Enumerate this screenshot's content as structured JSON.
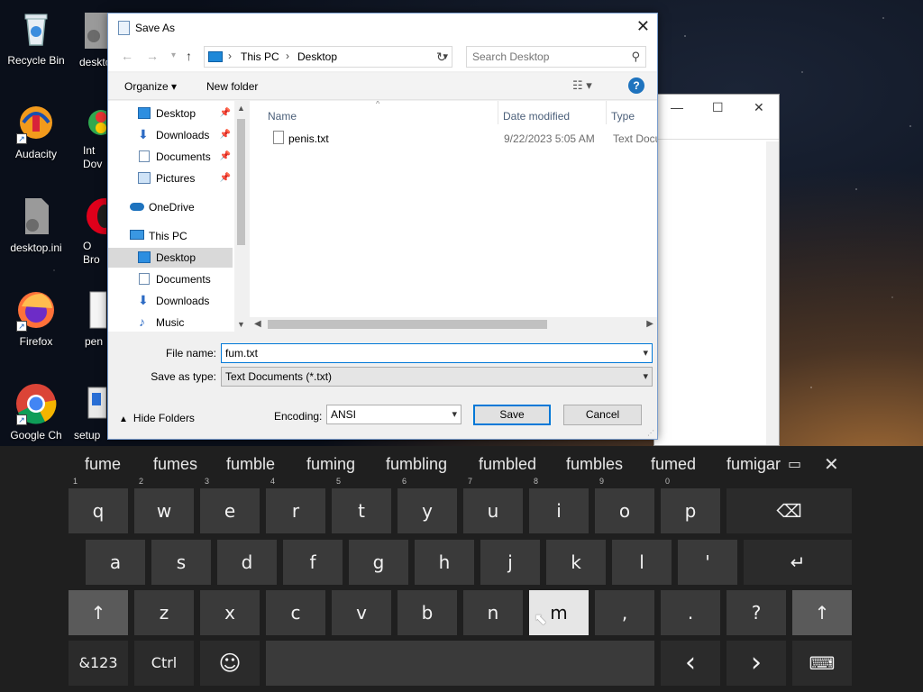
{
  "desktop": {
    "icons": [
      {
        "label": "Recycle Bin"
      },
      {
        "label": "Audacity"
      },
      {
        "label": "desktop.ini"
      },
      {
        "label": "Firefox"
      },
      {
        "label": "Google Ch"
      }
    ],
    "partial_icons": [
      {
        "label": "deskto"
      },
      {
        "label": "Int Dov"
      },
      {
        "label": "O Bro"
      },
      {
        "label": "pen"
      },
      {
        "label": "setup"
      }
    ]
  },
  "dialog": {
    "title": "Save As",
    "close_glyph": "✕",
    "address": {
      "crumbs": [
        "This PC",
        "Desktop"
      ],
      "separator": "›"
    },
    "search": {
      "placeholder": "Search Desktop"
    },
    "toolbar": {
      "organize": "Organize ▾",
      "new_folder": "New folder",
      "help": "?"
    },
    "nav_pane": {
      "quick_access": [
        {
          "label": "Desktop",
          "icon": "desktop-folder-icon"
        },
        {
          "label": "Downloads",
          "icon": "download-icon"
        },
        {
          "label": "Documents",
          "icon": "documents-icon"
        },
        {
          "label": "Pictures",
          "icon": "pictures-icon"
        }
      ],
      "onedrive": "OneDrive",
      "this_pc": "This PC",
      "this_pc_items": [
        {
          "label": "Desktop",
          "selected": true
        },
        {
          "label": "Documents",
          "selected": false
        },
        {
          "label": "Downloads",
          "selected": false
        },
        {
          "label": "Music",
          "selected": false
        }
      ]
    },
    "columns": [
      "Name",
      "Date modified",
      "Type"
    ],
    "files": [
      {
        "name": "penis.txt",
        "date_modified": "9/22/2023 5:05 AM",
        "type": "Text Docu"
      }
    ],
    "file_name_label": "File name:",
    "file_name_value": "fum.txt",
    "save_as_type_label": "Save as type:",
    "save_as_type_value": "Text Documents (*.txt)",
    "hide_folders": "Hide Folders",
    "encoding_label": "Encoding:",
    "encoding_value": "ANSI",
    "save_button": "Save",
    "cancel_button": "Cancel"
  },
  "keyboard": {
    "suggestions": [
      "fume",
      "fumes",
      "fumble",
      "fuming",
      "fumbling",
      "fumbled",
      "fumbles",
      "fumed",
      "fumigar"
    ],
    "row1": [
      {
        "k": "q",
        "n": "1"
      },
      {
        "k": "w",
        "n": "2"
      },
      {
        "k": "e",
        "n": "3"
      },
      {
        "k": "r",
        "n": "4"
      },
      {
        "k": "t",
        "n": "5"
      },
      {
        "k": "y",
        "n": "6"
      },
      {
        "k": "u",
        "n": "7"
      },
      {
        "k": "i",
        "n": "8"
      },
      {
        "k": "o",
        "n": "9"
      },
      {
        "k": "p",
        "n": "0"
      }
    ],
    "row2": [
      "a",
      "s",
      "d",
      "f",
      "g",
      "h",
      "j",
      "k",
      "l",
      "'"
    ],
    "row3": [
      "z",
      "x",
      "c",
      "v",
      "b",
      "n",
      "m",
      ",",
      ".",
      "?"
    ],
    "backspace": "⌫",
    "enter": "↵",
    "shift": "↑",
    "symbols": "&123",
    "ctrl": "Ctrl",
    "emoji": "☺",
    "left": "‹",
    "right": "›",
    "kb_switch": "⌨",
    "hovered_key": "m"
  }
}
